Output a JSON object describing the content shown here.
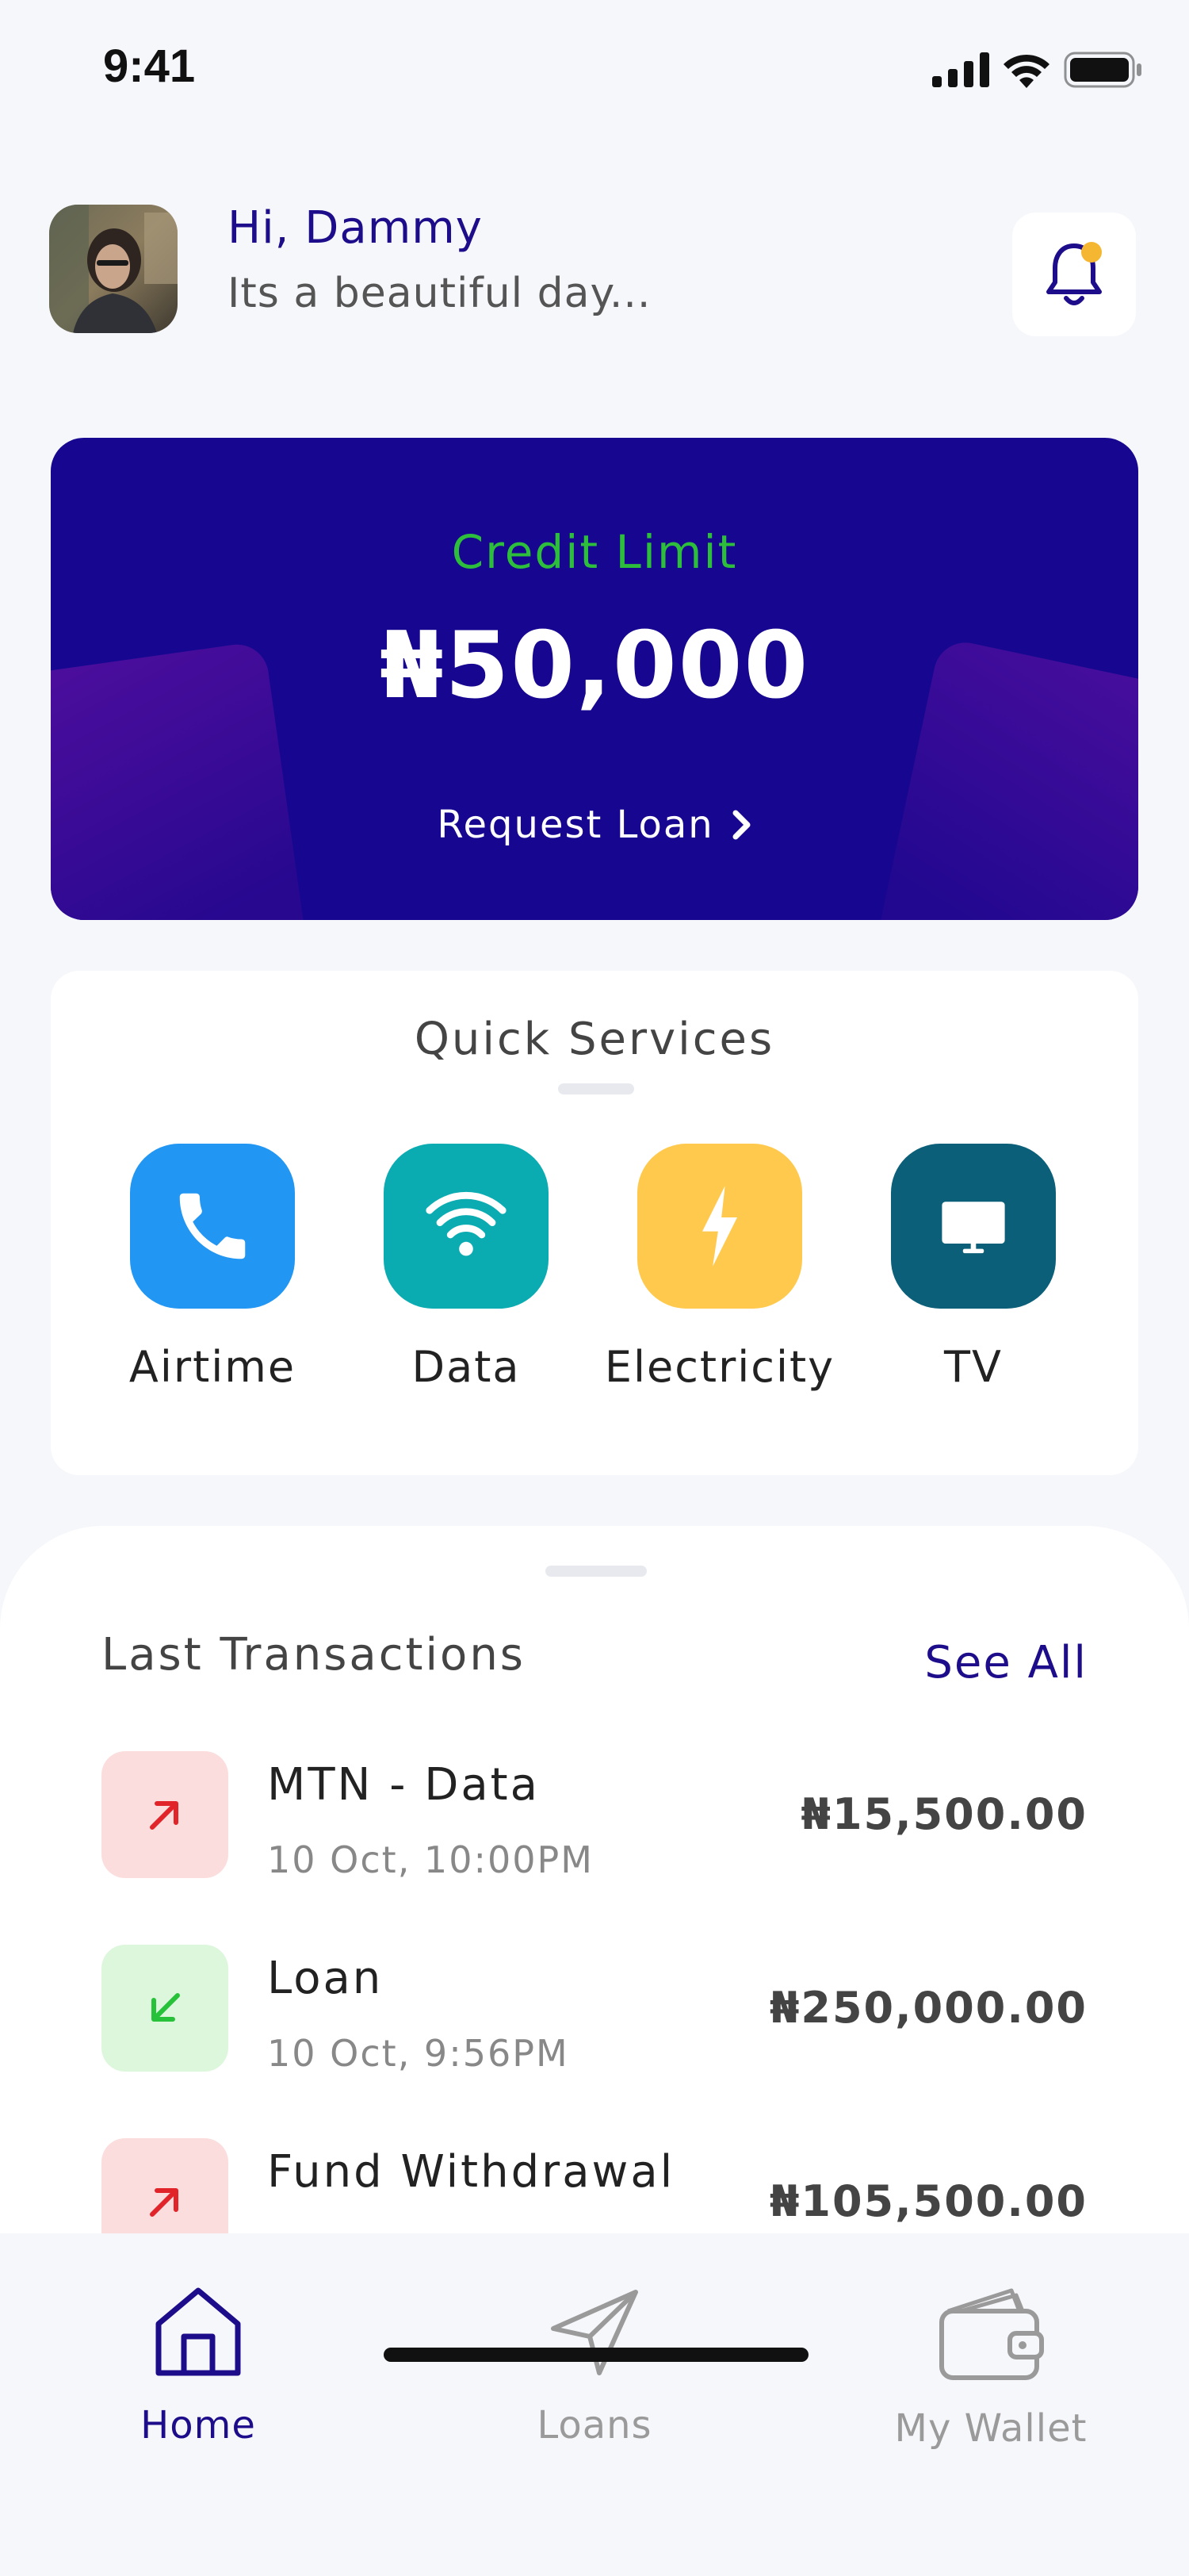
{
  "status_bar": {
    "time": "9:41"
  },
  "header": {
    "greeting": "Hi, Dammy",
    "subtitle": "Its a beautiful day..."
  },
  "credit_card": {
    "label": "Credit Limit",
    "amount": "₦50,000",
    "action_label": "Request Loan"
  },
  "quick_services": {
    "title": "Quick Services",
    "items": [
      {
        "label": "Airtime",
        "icon": "phone-icon",
        "color": "#2196F3"
      },
      {
        "label": "Data",
        "icon": "wifi-icon",
        "color": "#0BABB2"
      },
      {
        "label": "Electricity",
        "icon": "lightning-icon",
        "color": "#FFC94D"
      },
      {
        "label": "TV",
        "icon": "tv-icon",
        "color": "#0B5F78"
      }
    ]
  },
  "transactions": {
    "title": "Last Transactions",
    "see_all_label": "See All",
    "items": [
      {
        "name": "MTN - Data",
        "time": "10 Oct, 10:00PM",
        "amount": "₦15,500.00",
        "direction": "outgoing"
      },
      {
        "name": "Loan",
        "time": "10 Oct, 9:56PM",
        "amount": "₦250,000.00",
        "direction": "incoming"
      },
      {
        "name": "Fund Withdrawal",
        "time": "",
        "amount": "₦105,500.00",
        "direction": "outgoing"
      }
    ]
  },
  "bottom_nav": {
    "items": [
      {
        "label": "Home",
        "icon": "home-icon",
        "active": true
      },
      {
        "label": "Loans",
        "icon": "send-icon",
        "active": false
      },
      {
        "label": "My Wallet",
        "icon": "wallet-icon",
        "active": false
      }
    ]
  },
  "colors": {
    "brand": "#1D0D8A",
    "card": "#170790",
    "credit_label": "#2DBE3C",
    "outgoing_bg": "#FCDDDD",
    "outgoing_icon": "#E0242A",
    "incoming_bg": "#DDF7DD",
    "incoming_icon": "#27C23A",
    "inactive_nav": "#9A9A9A",
    "notification_dot": "#F5B731"
  }
}
